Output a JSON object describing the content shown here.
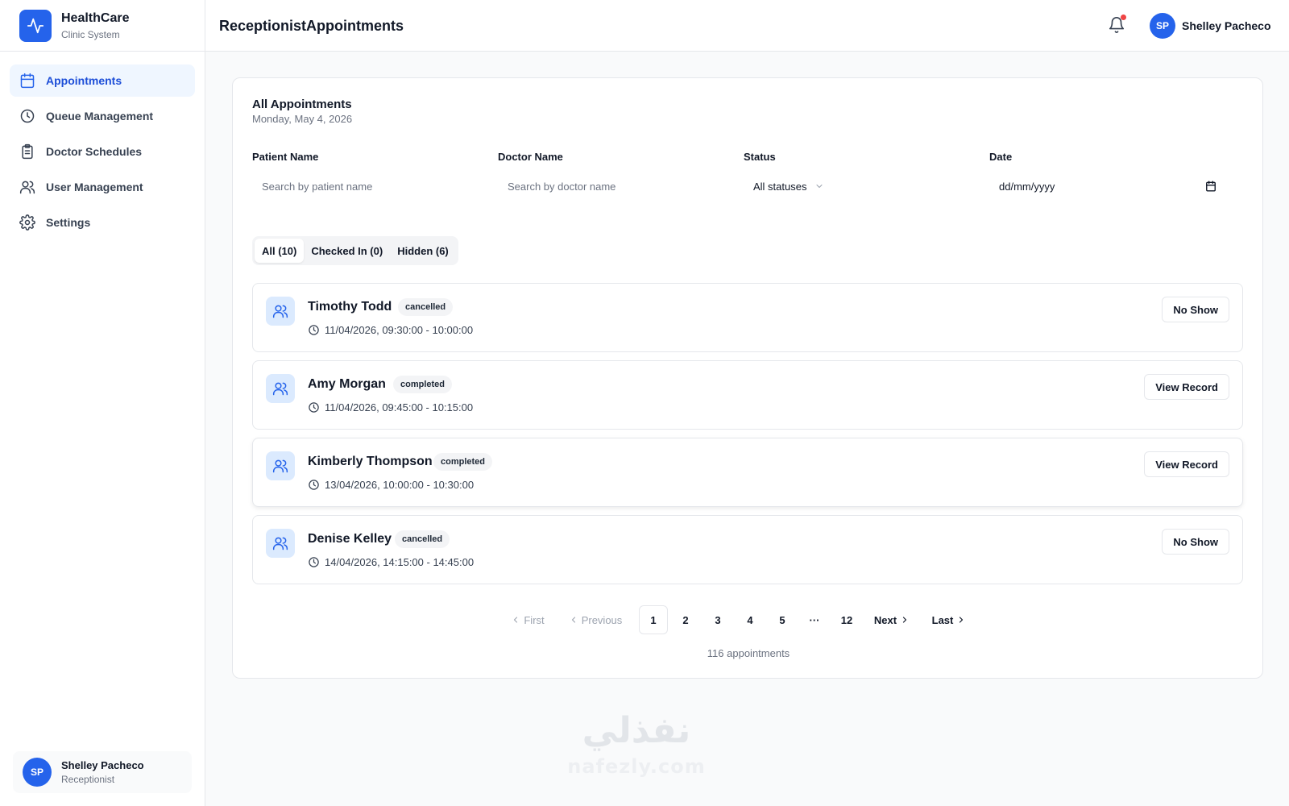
{
  "brand": {
    "name": "HealthCare",
    "subtitle": "Clinic System",
    "accent": "#2563eb"
  },
  "sidebar": {
    "items": [
      {
        "label": "Appointments",
        "icon": "calendar-icon",
        "active": true
      },
      {
        "label": "Queue Management",
        "icon": "clock-icon",
        "active": false
      },
      {
        "label": "Doctor Schedules",
        "icon": "clipboard-icon",
        "active": false
      },
      {
        "label": "User Management",
        "icon": "users-icon",
        "active": false
      },
      {
        "label": "Settings",
        "icon": "gear-icon",
        "active": false
      }
    ],
    "user": {
      "initials": "SP",
      "name": "Shelley Pacheco",
      "role": "Receptionist"
    }
  },
  "header": {
    "title": "ReceptionistAppointments",
    "user_initials": "SP",
    "user_name": "Shelley Pacheco",
    "notification_dot_color": "#ef4444"
  },
  "main": {
    "title": "All Appointments",
    "date": "Monday, May 4, 2026",
    "filters": {
      "patient": {
        "label": "Patient Name",
        "placeholder": "Search by patient name"
      },
      "doctor": {
        "label": "Doctor Name",
        "placeholder": "Search by doctor name"
      },
      "status": {
        "label": "Status",
        "value": "All statuses"
      },
      "date": {
        "label": "Date",
        "placeholder": "dd/mm/yyyy"
      }
    },
    "tabs": [
      {
        "label": "All (10)",
        "active": true
      },
      {
        "label": "Checked In (0)",
        "active": false
      },
      {
        "label": "Hidden (6)",
        "active": false
      }
    ],
    "appointments": [
      {
        "name": "Timothy Todd",
        "status": "cancelled",
        "time": "11/04/2026, 09:30:00 - 10:00:00",
        "action": "No Show"
      },
      {
        "name": "Amy Morgan",
        "status": "completed",
        "time": "11/04/2026, 09:45:00 - 10:15:00",
        "action": "View Record"
      },
      {
        "name": "Kimberly Thompson",
        "status": "completed",
        "time": "13/04/2026, 10:00:00 - 10:30:00",
        "action": "View Record"
      },
      {
        "name": "Denise Kelley",
        "status": "cancelled",
        "time": "14/04/2026, 14:15:00 - 14:45:00",
        "action": "No Show"
      }
    ],
    "pagination": {
      "first": "First",
      "previous": "Previous",
      "next": "Next",
      "last": "Last",
      "pages": [
        "1",
        "2",
        "3",
        "4",
        "5",
        "···",
        "12"
      ],
      "current": "1",
      "total": "116 appointments"
    }
  },
  "watermark": {
    "arabic": "نفذلي",
    "latin": "nafezly.com"
  }
}
